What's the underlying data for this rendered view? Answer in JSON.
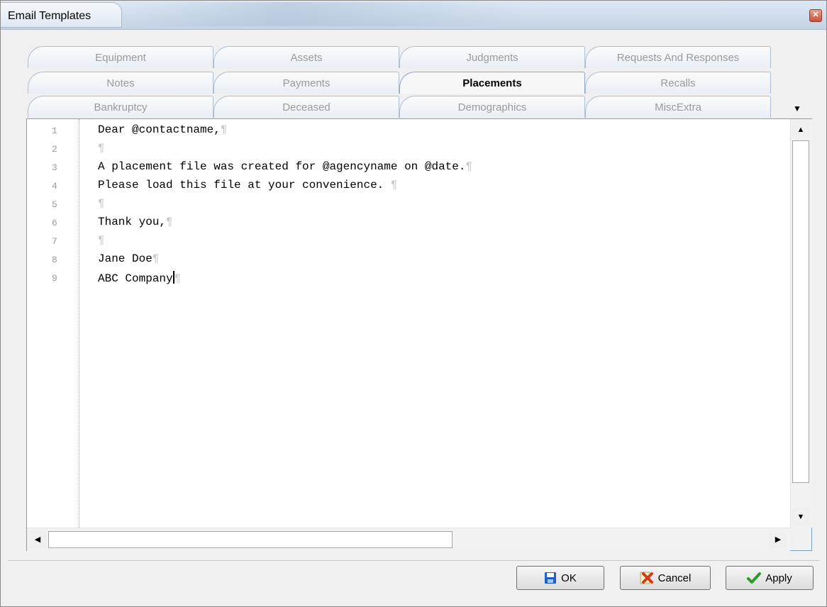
{
  "window": {
    "title": "Email Templates"
  },
  "tabs": {
    "row1": [
      "Equipment",
      "Assets",
      "Judgments",
      "Requests And Responses"
    ],
    "row2": [
      "Notes",
      "Payments",
      "Placements",
      "Recalls"
    ],
    "row3": [
      "Bankruptcy",
      "Deceased",
      "Demographics",
      "MiscExtra"
    ],
    "active": "Placements"
  },
  "editor": {
    "lines": [
      {
        "num": "1",
        "text": "Dear @contactname,"
      },
      {
        "num": "2",
        "text": ""
      },
      {
        "num": "3",
        "text": "A placement file was created for @agencyname on @date."
      },
      {
        "num": "4",
        "text": "Please load this file at your convenience. "
      },
      {
        "num": "5",
        "text": ""
      },
      {
        "num": "6",
        "text": "Thank you,"
      },
      {
        "num": "7",
        "text": ""
      },
      {
        "num": "8",
        "text": "Jane Doe"
      },
      {
        "num": "9",
        "text": "ABC Company"
      }
    ],
    "pilcrow": "¶"
  },
  "buttons": {
    "ok": "OK",
    "cancel": "Cancel",
    "apply": "Apply"
  },
  "colors": {
    "accent_blue": "#1f5fbf",
    "check_green": "#2e9b2e",
    "cancel_red": "#d23a1a"
  }
}
